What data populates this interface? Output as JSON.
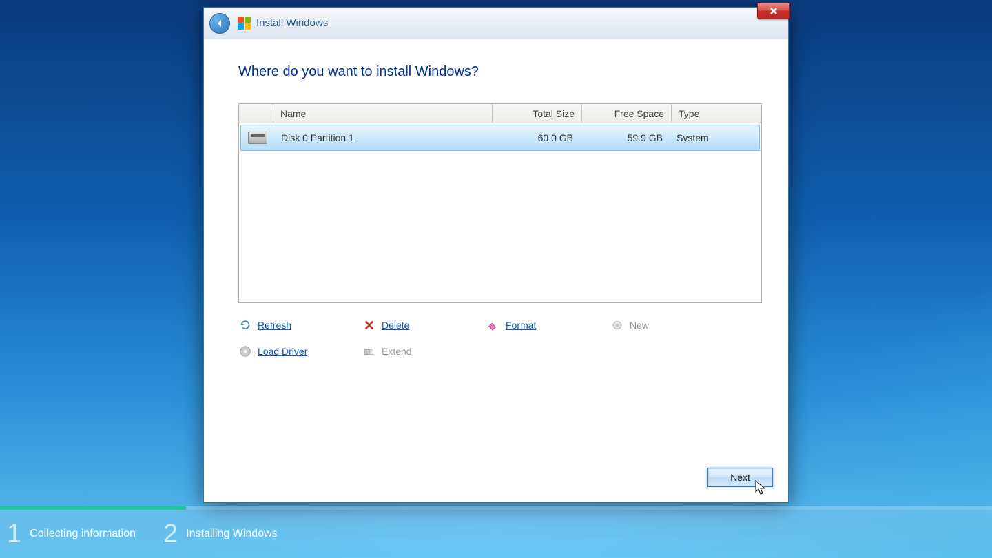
{
  "titlebar": {
    "title": "Install Windows"
  },
  "heading": "Where do you want to install Windows?",
  "columns": {
    "name": "Name",
    "total_size": "Total Size",
    "free_space": "Free Space",
    "type": "Type"
  },
  "partitions": [
    {
      "name": "Disk 0 Partition 1",
      "total_size": "60.0 GB",
      "free_space": "59.9 GB",
      "type": "System",
      "selected": true
    }
  ],
  "actions": {
    "refresh": "Refresh",
    "delete": "Delete",
    "format": "Format",
    "new": "New",
    "load_driver": "Load Driver",
    "extend": "Extend"
  },
  "next_button": "Next",
  "steps": {
    "step1_num": "1",
    "step1_label": "Collecting information",
    "step2_num": "2",
    "step2_label": "Installing Windows"
  }
}
